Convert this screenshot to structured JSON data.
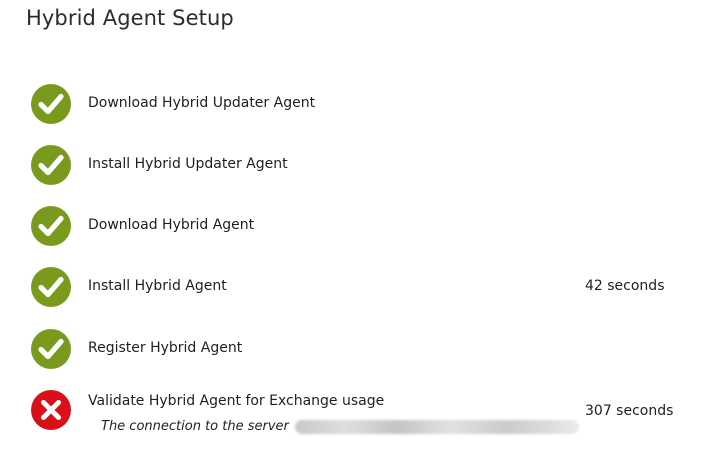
{
  "window": {
    "title": "Hybrid Agent Setup"
  },
  "colors": {
    "success": "#7a9a1e",
    "error": "#d90f1a"
  },
  "steps": [
    {
      "label": "Download Hybrid Updater Agent",
      "status": "success",
      "icon": "check-icon",
      "duration": ""
    },
    {
      "label": "Install Hybrid Updater Agent",
      "status": "success",
      "icon": "check-icon",
      "duration": ""
    },
    {
      "label": "Download Hybrid Agent",
      "status": "success",
      "icon": "check-icon",
      "duration": ""
    },
    {
      "label": "Install Hybrid Agent",
      "status": "success",
      "icon": "check-icon",
      "duration": "42 seconds"
    },
    {
      "label": "Register Hybrid Agent",
      "status": "success",
      "icon": "check-icon",
      "duration": ""
    },
    {
      "label": "Validate Hybrid Agent for Exchange usage",
      "status": "error",
      "icon": "error-x-icon",
      "duration": "307 seconds",
      "error_message": "The connection to the server"
    }
  ]
}
